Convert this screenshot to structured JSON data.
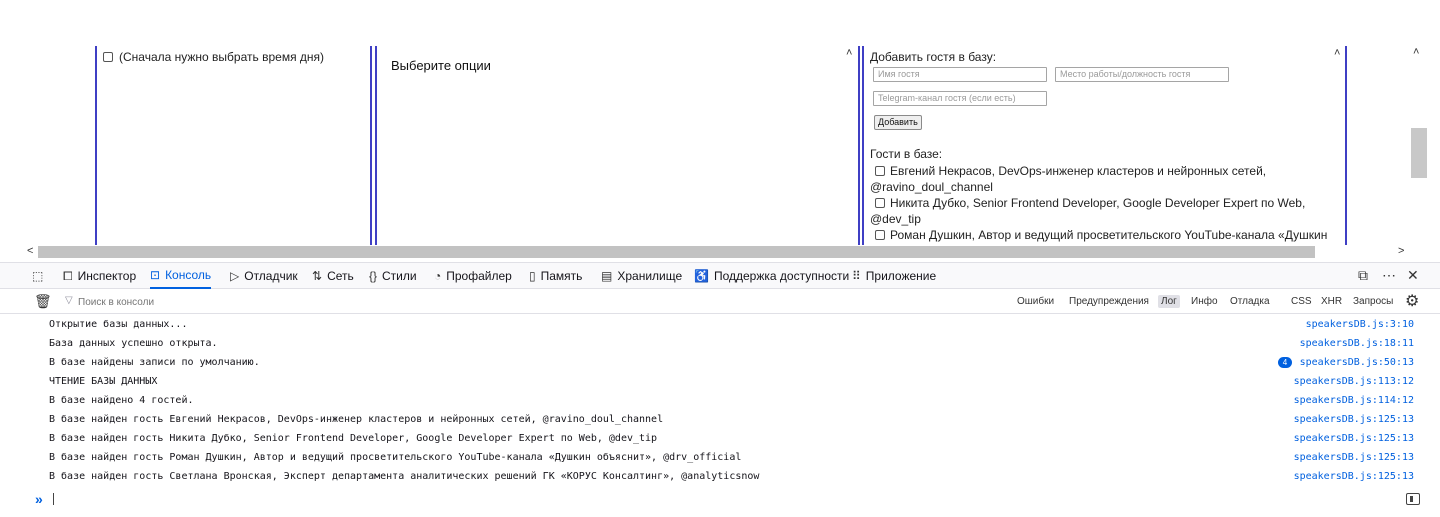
{
  "page": {
    "col1": {
      "checkbox_label": "(Сначала нужно выбрать время дня)"
    },
    "col2": {
      "title": "Выберите опции"
    },
    "col3": {
      "title": "Добавить гостя в базу:",
      "name_placeholder": "Имя гостя",
      "job_placeholder": "Место работы/должность гостя",
      "telegram_placeholder": "Telegram-канал гостя (если есть)",
      "add_button": "Добавить",
      "guests_title": "Гости в базе:",
      "guests": [
        {
          "line1": "Евгений Некрасов, DevOps-инженер кластеров и нейронных сетей,",
          "line2": "@ravino_doul_channel"
        },
        {
          "line1": "Никита Дубко, Senior Frontend Developer, Google Developer Expert по Web,",
          "line2": "@dev_tip"
        },
        {
          "line1": "Роман Душкин, Автор и ведущий просветительского YouTube-канала «Душкин",
          "line2": ""
        }
      ]
    },
    "scroll_up_glyph": "˄",
    "scroll_left_glyph": "<",
    "scroll_right_glyph": ">"
  },
  "devtools": {
    "tabs": [
      {
        "id": "inspector",
        "label": "Инспектор",
        "icon": "⧠"
      },
      {
        "id": "console",
        "label": "Консоль",
        "icon": "⊡",
        "active": true
      },
      {
        "id": "debugger",
        "label": "Отладчик",
        "icon": "▷"
      },
      {
        "id": "network",
        "label": "Сеть",
        "icon": "⇅"
      },
      {
        "id": "styles",
        "label": "Стили",
        "icon": "{}"
      },
      {
        "id": "profiler",
        "label": "Профайлер",
        "icon": "◔"
      },
      {
        "id": "memory",
        "label": "Память",
        "icon": "▯"
      },
      {
        "id": "storage",
        "label": "Хранилище",
        "icon": "▤"
      },
      {
        "id": "accessibility",
        "label": "Поддержка доступности",
        "icon": "♿"
      },
      {
        "id": "application",
        "label": "Приложение",
        "icon": "⠿"
      }
    ],
    "picker_icon": "⬚",
    "dock_icon": "⧉",
    "more_icon": "⋯",
    "close_icon": "✕",
    "filter_placeholder": "Поиск в консоли",
    "filter_icon": "▽",
    "trash_icon": "🗑",
    "levels": [
      {
        "label": "Ошибки",
        "on": false
      },
      {
        "label": "Предупреждения",
        "on": false
      },
      {
        "label": "Лог",
        "on": true
      },
      {
        "label": "Инфо",
        "on": false
      },
      {
        "label": "Отладка",
        "on": false
      }
    ],
    "types": [
      {
        "label": "CSS"
      },
      {
        "label": "XHR"
      },
      {
        "label": "Запросы"
      }
    ],
    "gear_icon": "⚙",
    "messages": [
      {
        "text": "Открытие базы данных...",
        "source": "speakersDB.js:3:10",
        "count": ""
      },
      {
        "text": "База данных успешно открыта.",
        "source": "speakersDB.js:18:11",
        "count": ""
      },
      {
        "text": "В базе найдены записи по умолчанию.",
        "source": "speakersDB.js:50:13",
        "count": "4"
      },
      {
        "text": "ЧТЕНИЕ БАЗЫ ДАННЫХ",
        "source": "speakersDB.js:113:12",
        "count": ""
      },
      {
        "text": "В базе найдено 4 гостей.",
        "source": "speakersDB.js:114:12",
        "count": ""
      },
      {
        "text": "В базе найден гость Евгений Некрасов, DevOps-инженер кластеров и нейронных сетей, @ravino_doul_channel",
        "source": "speakersDB.js:125:13",
        "count": ""
      },
      {
        "text": "В базе найден гость Никита Дубко, Senior Frontend Developer, Google Developer Expert по Web, @dev_tip",
        "source": "speakersDB.js:125:13",
        "count": ""
      },
      {
        "text": "В базе найден гость Роман Душкин, Автор и ведущий просветительского YouTube-канала «Душкин объяснит», @drv_official",
        "source": "speakersDB.js:125:13",
        "count": ""
      },
      {
        "text": "В базе найден гость Светлана Вронская, Эксперт департамента аналитических решений ГК «КОРУС Консалтинг», @analyticsnow",
        "source": "speakersDB.js:125:13",
        "count": ""
      }
    ],
    "prompt_glyph": "»"
  }
}
